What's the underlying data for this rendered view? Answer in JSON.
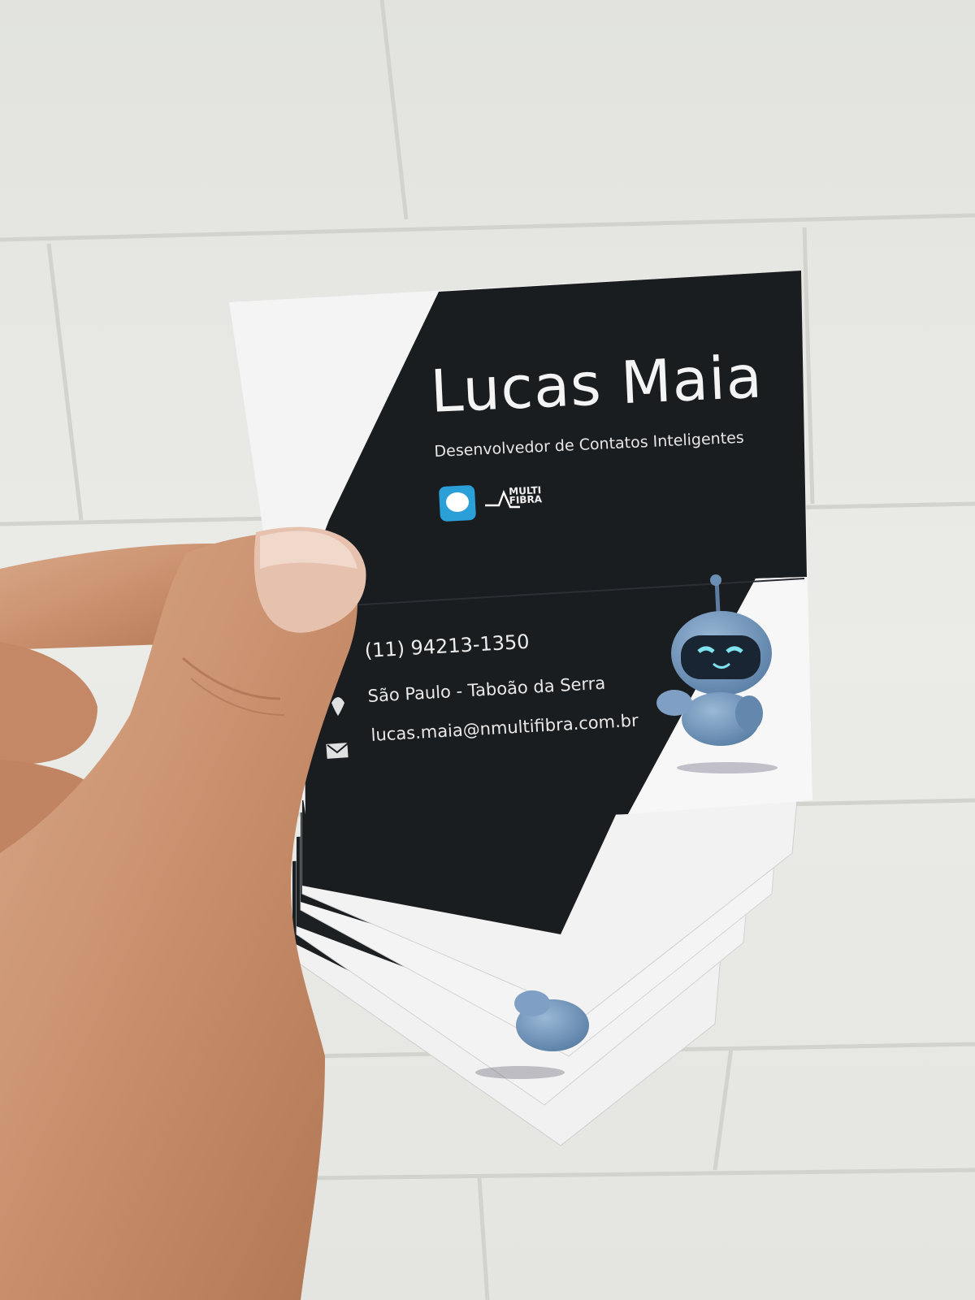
{
  "card": {
    "name": "Lucas Maia",
    "title": "Desenvolvedor de Contatos Inteligentes",
    "brand": {
      "line1": "MULTI",
      "line2": "FIBRA",
      "icon": "chat-bubble-logo"
    },
    "phone": "(11) 94213-1350",
    "location": "São Paulo - Taboão da Serra",
    "email": "lucas.maia@nmultifibra.com.br",
    "mascot": "blue-robot-mascot",
    "colors": {
      "dark": "#1a1d20",
      "light": "#f4f4f4",
      "accent": "#6e95bc"
    }
  }
}
